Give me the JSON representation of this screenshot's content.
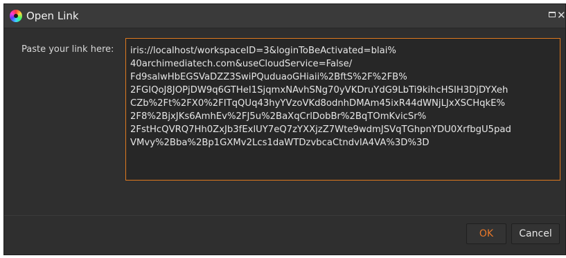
{
  "window": {
    "title": "Open Link",
    "icon": "color-wheel-icon",
    "controls": {
      "maximize_icon": "maximize-icon",
      "close_label": "✕"
    }
  },
  "form": {
    "link_label": "Paste your link here:",
    "link_value": "iris://localhost/workspaceID=3&loginToBeActivated=blai%\n40archimediatech.com&useCloudService=False/\nFd9salwHbEGSVaDZZ3SwiPQuduaoGHiaii%2BftS%2F%2FB%\n2FGIQoJ8JOPjDW9q6GTHeI1SjqmxNAvhSNg70yVKDruYdG9LbTi9kihcHSIH3DjDYXeh\nCZb%2Ft%2FX0%2FITqQUq43hyYVzoVKd8odnhDMAm45ixR44dWNjLJxXSCHqkE%\n2F8%2BjxJKs6AmhEv%2FJ5u%2BaXqCrlDobBr%2BqTOmKvicSr%\n2FstHcQVRQ7Hh0ZxJb3fExlUY7eQ7zYXXjzZ7Wte9wdmJSVqTGhpnYDU0XrfbgU5pad\nVMvy%2Bba%2Bp1GXMv2Lcs1daWTDzvbcaCtndvIA4VA%3D%3D"
  },
  "buttons": {
    "ok_label": "OK",
    "cancel_label": "Cancel"
  },
  "colors": {
    "background": "#2f2f2f",
    "accent": "#e07a1f",
    "text": "#e6e6e6"
  }
}
